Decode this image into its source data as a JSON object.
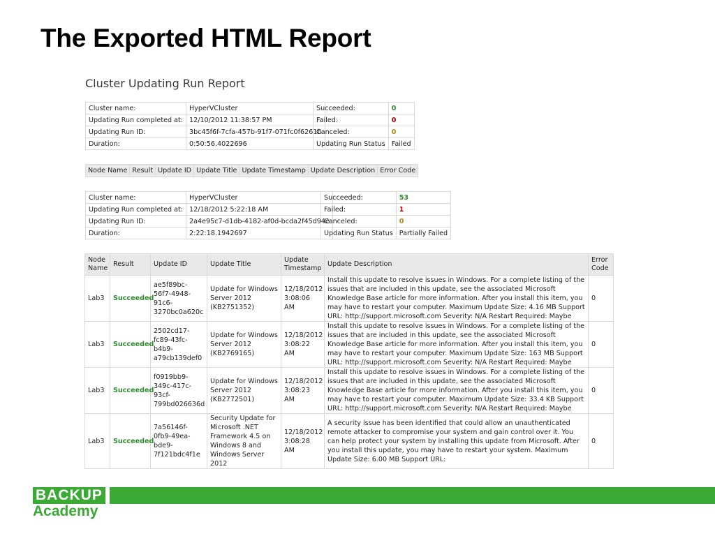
{
  "slide": {
    "title": "The Exported HTML Report"
  },
  "report": {
    "title": "Cluster Updating Run Report"
  },
  "run1": {
    "info": [
      {
        "label": "Cluster name:",
        "value": "HyperVCluster"
      },
      {
        "label": "Updating Run completed at:",
        "value": "12/10/2012 11:38:57 PM"
      },
      {
        "label": "Updating Run ID:",
        "value": "3bc45f6f-7cfa-457b-91f7-071fc0f6261b"
      },
      {
        "label": "Duration:",
        "value": "0:50:56.4022696"
      }
    ],
    "status": [
      {
        "label": "Succeeded:",
        "value": "0"
      },
      {
        "label": "Failed:",
        "value": "0"
      },
      {
        "label": "Canceled:",
        "value": "0"
      },
      {
        "label": "Updating Run Status",
        "value": "Failed"
      }
    ],
    "columns": [
      "Node Name",
      "Result",
      "Update ID",
      "Update Title",
      "Update Timestamp",
      "Update Description",
      "Error Code"
    ]
  },
  "run2": {
    "info": [
      {
        "label": "Cluster name:",
        "value": "HyperVCluster"
      },
      {
        "label": "Updating Run completed at:",
        "value": "12/18/2012 5:22:18 AM"
      },
      {
        "label": "Updating Run ID:",
        "value": "2a4e95c7-d1db-4182-af0d-bcda2f45d94e"
      },
      {
        "label": "Duration:",
        "value": "2:22:18.1942697"
      }
    ],
    "status": [
      {
        "label": "Succeeded:",
        "value": "53"
      },
      {
        "label": "Failed:",
        "value": "1"
      },
      {
        "label": "Canceled:",
        "value": "0"
      },
      {
        "label": "Updating Run Status",
        "value": "Partially Failed"
      }
    ],
    "columns": [
      "Node Name",
      "Result",
      "Update ID",
      "Update Title",
      "Update Timestamp",
      "Update Description",
      "Error Code"
    ],
    "rows": [
      {
        "node": "Lab3",
        "result": "Succeeded",
        "id": "ae5f89bc-56f7-4948-91c6-3270bc0a620c",
        "title": "Update for Windows Server 2012 (KB2751352)",
        "timestamp": "12/18/2012 3:08:06 AM",
        "description": "Install this update to resolve issues in Windows. For a complete listing of the issues that are included in this update, see the associated Microsoft Knowledge Base article for more information. After you install this item, you may have to restart your computer. Maximum Update Size: 4.16 MB Support URL: http://support.microsoft.com Severity: N/A Restart Required: Maybe",
        "error": "0"
      },
      {
        "node": "Lab3",
        "result": "Succeeded",
        "id": "2502cd17-fc89-43fc-b4b9-a79cb139def0",
        "title": "Update for Windows Server 2012 (KB2769165)",
        "timestamp": "12/18/2012 3:08:22 AM",
        "description": "Install this update to resolve issues in Windows. For a complete listing of the issues that are included in this update, see the associated Microsoft Knowledge Base article for more information. After you install this item, you may have to restart your computer. Maximum Update Size: 163 MB Support URL: http://support.microsoft.com Severity: N/A Restart Required: Maybe",
        "error": "0"
      },
      {
        "node": "Lab3",
        "result": "Succeeded",
        "id": "f0919bb9-349c-417c-93cf-799bd026636d",
        "title": "Update for Windows Server 2012 (KB2772501)",
        "timestamp": "12/18/2012 3:08:23 AM",
        "description": "Install this update to resolve issues in Windows. For a complete listing of the issues that are included in this update, see the associated Microsoft Knowledge Base article for more information. After you install this item, you may have to restart your computer. Maximum Update Size: 33.4 KB Support URL: http://support.microsoft.com Severity: N/A Restart Required: Maybe",
        "error": "0"
      },
      {
        "node": "Lab3",
        "result": "Succeeded",
        "id": "7a56146f-0fb9-49ea-bde9-7f121bdc4f1e",
        "title": "Security Update for Microsoft .NET Framework 4.5 on Windows 8 and Windows Server 2012",
        "timestamp": "12/18/2012 3:08:28 AM",
        "description": "A security issue has been identified that could allow an unauthenticated remote attacker to compromise your system and gain control over it. You can help protect your system by installing this update from Microsoft. After you install this update, you may have to restart your system. Maximum Update Size: 6.00 MB Support URL:",
        "error": "0"
      }
    ]
  },
  "footer": {
    "logo_top": "BACKUP",
    "logo_bottom": "Academy",
    "brand_color": "#3aaa35"
  }
}
